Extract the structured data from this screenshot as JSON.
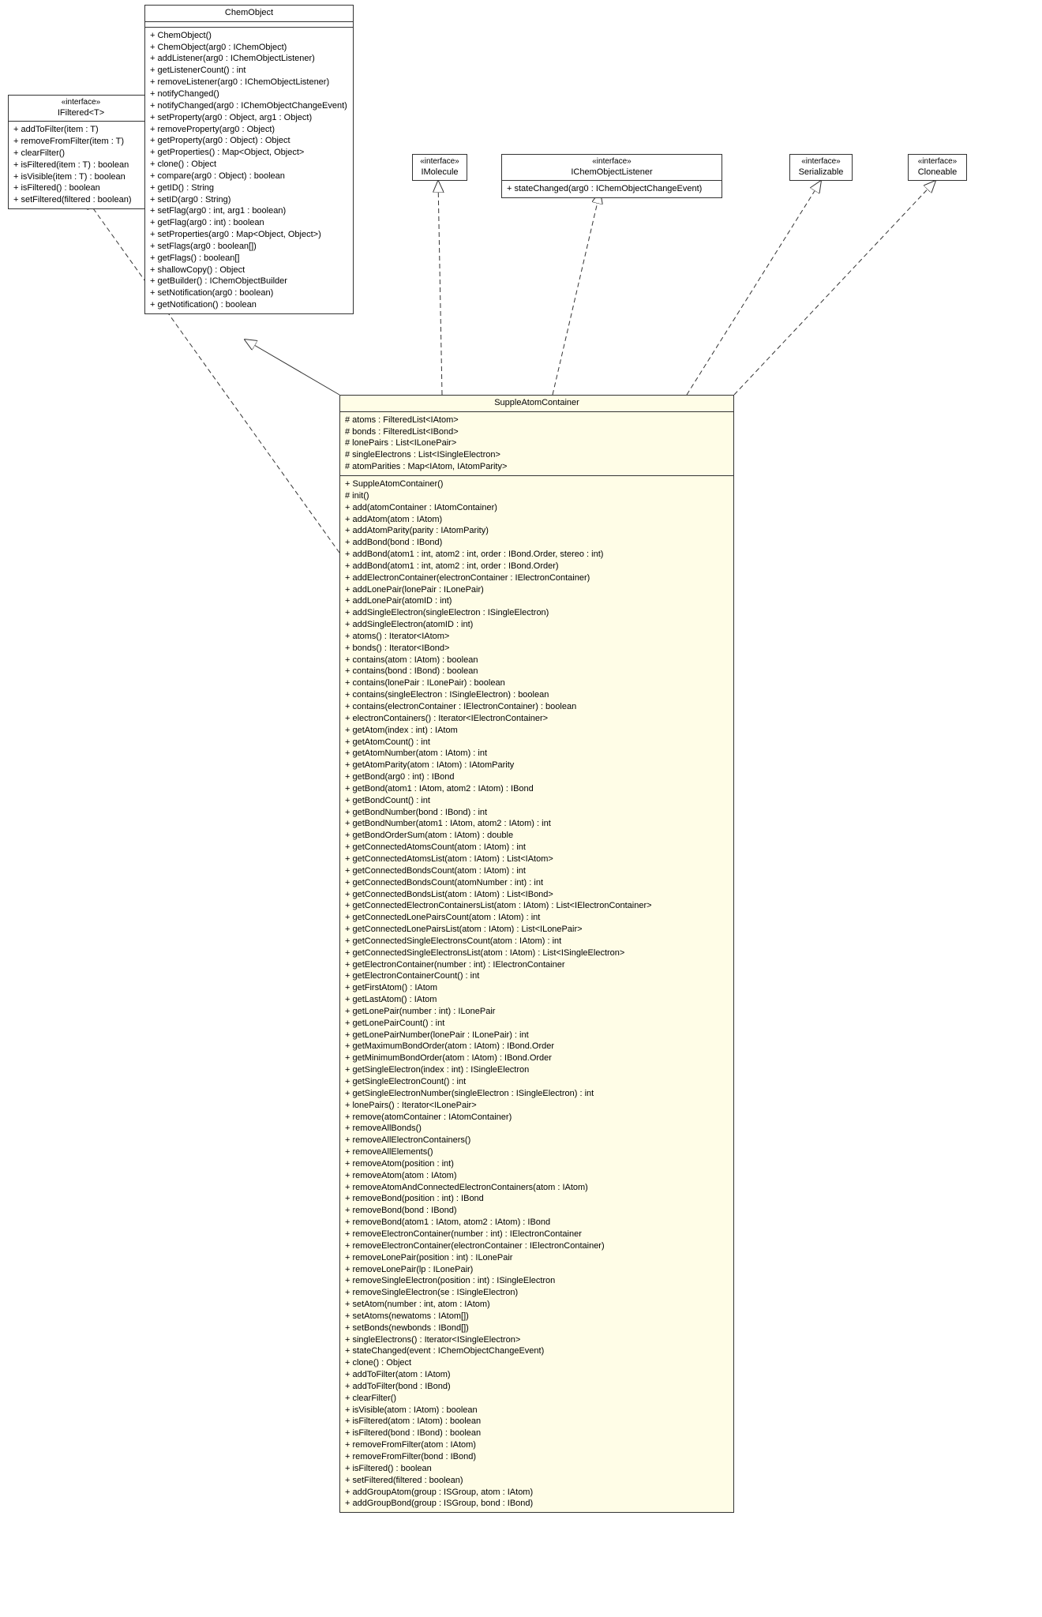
{
  "classes": {
    "ifiltered": {
      "stereotype": "«interface»",
      "name": "IFiltered<T>",
      "attributes": [],
      "methods": [
        "+ addToFilter(item : T)",
        "+ removeFromFilter(item : T)",
        "+ clearFilter()",
        "+ isFiltered(item : T) : boolean",
        "+ isVisible(item : T) : boolean",
        "+ isFiltered() : boolean",
        "+ setFiltered(filtered : boolean)"
      ]
    },
    "chemobject": {
      "stereotype": "",
      "name": "ChemObject",
      "attributes": [],
      "methods": [
        "+ ChemObject()",
        "+ ChemObject(arg0 : IChemObject)",
        "+ addListener(arg0 : IChemObjectListener)",
        "+ getListenerCount() : int",
        "+ removeListener(arg0 : IChemObjectListener)",
        "+ notifyChanged()",
        "+ notifyChanged(arg0 : IChemObjectChangeEvent)",
        "+ setProperty(arg0 : Object, arg1 : Object)",
        "+ removeProperty(arg0 : Object)",
        "+ getProperty(arg0 : Object) : Object",
        "+ getProperties() : Map<Object, Object>",
        "+ clone() : Object",
        "+ compare(arg0 : Object) : boolean",
        "+ getID() : String",
        "+ setID(arg0 : String)",
        "+ setFlag(arg0 : int, arg1 : boolean)",
        "+ getFlag(arg0 : int) : boolean",
        "+ setProperties(arg0 : Map<Object, Object>)",
        "+ setFlags(arg0 : boolean[])",
        "+ getFlags() : boolean[]",
        "+ shallowCopy() : Object",
        "+ getBuilder() : IChemObjectBuilder",
        "+ setNotification(arg0 : boolean)",
        "+ getNotification() : boolean"
      ]
    },
    "imolecule": {
      "stereotype": "«interface»",
      "name": "IMolecule"
    },
    "ichemobjectlistener": {
      "stereotype": "«interface»",
      "name": "IChemObjectListener",
      "methods": [
        "+ stateChanged(arg0 : IChemObjectChangeEvent)"
      ]
    },
    "serializable": {
      "stereotype": "«interface»",
      "name": "Serializable"
    },
    "cloneable": {
      "stereotype": "«interface»",
      "name": "Cloneable"
    },
    "suppleatomcontainer": {
      "stereotype": "",
      "name": "SuppleAtomContainer",
      "attributes": [
        "# atoms : FilteredList<IAtom>",
        "# bonds : FilteredList<IBond>",
        "# lonePairs : List<ILonePair>",
        "# singleElectrons : List<ISingleElectron>",
        "# atomParities : Map<IAtom, IAtomParity>"
      ],
      "methods": [
        "+ SuppleAtomContainer()",
        "# init()",
        "+ add(atomContainer : IAtomContainer)",
        "+ addAtom(atom : IAtom)",
        "+ addAtomParity(parity : IAtomParity)",
        "+ addBond(bond : IBond)",
        "+ addBond(atom1 : int, atom2 : int, order : IBond.Order, stereo : int)",
        "+ addBond(atom1 : int, atom2 : int, order : IBond.Order)",
        "+ addElectronContainer(electronContainer : IElectronContainer)",
        "+ addLonePair(lonePair : ILonePair)",
        "+ addLonePair(atomID : int)",
        "+ addSingleElectron(singleElectron : ISingleElectron)",
        "+ addSingleElectron(atomID : int)",
        "+ atoms() : Iterator<IAtom>",
        "+ bonds() : Iterator<IBond>",
        "+ contains(atom : IAtom) : boolean",
        "+ contains(bond : IBond) : boolean",
        "+ contains(lonePair : ILonePair) : boolean",
        "+ contains(singleElectron : ISingleElectron) : boolean",
        "+ contains(electronContainer : IElectronContainer) : boolean",
        "+ electronContainers() : Iterator<IElectronContainer>",
        "+ getAtom(index : int) : IAtom",
        "+ getAtomCount() : int",
        "+ getAtomNumber(atom : IAtom) : int",
        "+ getAtomParity(atom : IAtom) : IAtomParity",
        "+ getBond(arg0 : int) : IBond",
        "+ getBond(atom1 : IAtom, atom2 : IAtom) : IBond",
        "+ getBondCount() : int",
        "+ getBondNumber(bond : IBond) : int",
        "+ getBondNumber(atom1 : IAtom, atom2 : IAtom) : int",
        "+ getBondOrderSum(atom : IAtom) : double",
        "+ getConnectedAtomsCount(atom : IAtom) : int",
        "+ getConnectedAtomsList(atom : IAtom) : List<IAtom>",
        "+ getConnectedBondsCount(atom : IAtom) : int",
        "+ getConnectedBondsCount(atomNumber : int) : int",
        "+ getConnectedBondsList(atom : IAtom) : List<IBond>",
        "+ getConnectedElectronContainersList(atom : IAtom) : List<IElectronContainer>",
        "+ getConnectedLonePairsCount(atom : IAtom) : int",
        "+ getConnectedLonePairsList(atom : IAtom) : List<ILonePair>",
        "+ getConnectedSingleElectronsCount(atom : IAtom) : int",
        "+ getConnectedSingleElectronsList(atom : IAtom) : List<ISingleElectron>",
        "+ getElectronContainer(number : int) : IElectronContainer",
        "+ getElectronContainerCount() : int",
        "+ getFirstAtom() : IAtom",
        "+ getLastAtom() : IAtom",
        "+ getLonePair(number : int) : ILonePair",
        "+ getLonePairCount() : int",
        "+ getLonePairNumber(lonePair : ILonePair) : int",
        "+ getMaximumBondOrder(atom : IAtom) : IBond.Order",
        "+ getMinimumBondOrder(atom : IAtom) : IBond.Order",
        "+ getSingleElectron(index : int) : ISingleElectron",
        "+ getSingleElectronCount() : int",
        "+ getSingleElectronNumber(singleElectron : ISingleElectron) : int",
        "+ lonePairs() : Iterator<ILonePair>",
        "+ remove(atomContainer : IAtomContainer)",
        "+ removeAllBonds()",
        "+ removeAllElectronContainers()",
        "+ removeAllElements()",
        "+ removeAtom(position : int)",
        "+ removeAtom(atom : IAtom)",
        "+ removeAtomAndConnectedElectronContainers(atom : IAtom)",
        "+ removeBond(position : int) : IBond",
        "+ removeBond(bond : IBond)",
        "+ removeBond(atom1 : IAtom, atom2 : IAtom) : IBond",
        "+ removeElectronContainer(number : int) : IElectronContainer",
        "+ removeElectronContainer(electronContainer : IElectronContainer)",
        "+ removeLonePair(position : int) : ILonePair",
        "+ removeLonePair(lp : ILonePair)",
        "+ removeSingleElectron(position : int) : ISingleElectron",
        "+ removeSingleElectron(se : ISingleElectron)",
        "+ setAtom(number : int, atom : IAtom)",
        "+ setAtoms(newatoms : IAtom[])",
        "+ setBonds(newbonds : IBond[])",
        "+ singleElectrons() : Iterator<ISingleElectron>",
        "+ stateChanged(event : IChemObjectChangeEvent)",
        "+ clone() : Object",
        "+ addToFilter(atom : IAtom)",
        "+ addToFilter(bond : IBond)",
        "+ clearFilter()",
        "+ isVisible(atom : IAtom) : boolean",
        "+ isFiltered(atom : IAtom) : boolean",
        "+ isFiltered(bond : IBond) : boolean",
        "+ removeFromFilter(atom : IAtom)",
        "+ removeFromFilter(bond : IBond)",
        "+ isFiltered() : boolean",
        "+ setFiltered(filtered : boolean)",
        "+ addGroupAtom(group : ISGroup, atom : IAtom)",
        "+ addGroupBond(group : ISGroup, bond : IBond)"
      ]
    }
  }
}
